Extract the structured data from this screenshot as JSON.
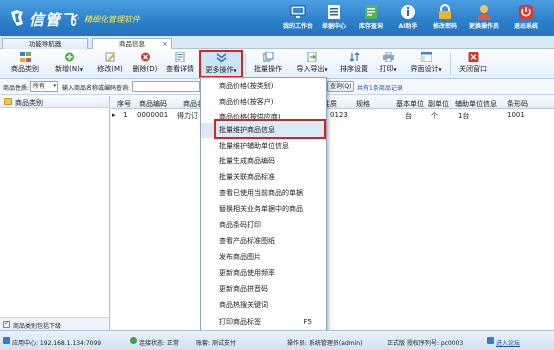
{
  "app": {
    "name": "信管飞",
    "slogan": "精细化管理软件"
  },
  "header_buttons": [
    {
      "label": "我的工作台",
      "icon": "monitor-icon",
      "color": "#2d6fb7"
    },
    {
      "label": "单据中心",
      "icon": "list-icon",
      "color": "#2b5ea8"
    },
    {
      "label": "库存查询",
      "icon": "document-icon",
      "color": "#3aa047"
    },
    {
      "label": "AI助手",
      "icon": "info-icon",
      "color": "#2a66b3"
    },
    {
      "label": "修改密码",
      "icon": "lock-icon",
      "color": "#e5a21e"
    },
    {
      "label": "更换操作员",
      "icon": "user-icon",
      "color": "#f0b43a"
    },
    {
      "label": "退出系统",
      "icon": "power-icon",
      "color": "#d93a2f"
    }
  ],
  "tabs": [
    {
      "label": "功能导航器"
    },
    {
      "label": "商品信息",
      "close": "×"
    }
  ],
  "toolbar": [
    {
      "label": "商品类别",
      "icon": "category-icon"
    },
    {
      "label": "新增(N)",
      "icon": "add-icon",
      "dropdown": "▼"
    },
    {
      "label": "修改(M)",
      "icon": "edit-icon"
    },
    {
      "label": "删除(D)",
      "icon": "delete-icon"
    },
    {
      "label": "查看详情",
      "icon": "detail-icon"
    },
    {
      "label": "更多操作",
      "icon": "more-icon",
      "dropdown": "▼"
    },
    {
      "label": "批量操作",
      "icon": "batch-icon"
    },
    {
      "label": "导入导出",
      "icon": "import-export-icon",
      "dropdown": "▼"
    },
    {
      "label": "排序设置",
      "icon": "sort-icon"
    },
    {
      "label": "打印",
      "icon": "print-icon",
      "dropdown": "▼"
    },
    {
      "label": "界面设计",
      "icon": "design-icon",
      "dropdown": "▼"
    },
    {
      "label": "关闭窗口",
      "icon": "close-window-icon"
    }
  ],
  "filter": {
    "property_label": "商品性质:",
    "property_value": "所有",
    "search_label": "输入商品名称或编码查询:",
    "query_button": "查询(Q)",
    "result_text": "共有1条商品记录"
  },
  "left_panel": {
    "tree_root": "商品类别",
    "footer_checkbox": "商品类别包括下级"
  },
  "grid": {
    "columns": [
      "序号",
      "商品编码",
      "商品名称",
      "性质",
      "规格",
      "基本单位",
      "副单位",
      "辅助单位信息",
      "条形码"
    ],
    "rows": [
      {
        "marker": "▸",
        "index": "1",
        "code": "0000001",
        "name": "得力订",
        "barcode_partial": "0123",
        "property": "",
        "spec": "",
        "unit": "台",
        "sub_unit": "个",
        "aux": "1台",
        "barcode": "1001"
      }
    ]
  },
  "more_menu": {
    "items": [
      {
        "label": "商品价格(按类别)"
      },
      {
        "label": "商品价格(按客户)"
      },
      {
        "label": "商品价格(按供应商)"
      },
      {
        "label": "批量维护商品信息",
        "highlight": true
      },
      {
        "label": "批量维护辅助单位信息"
      },
      {
        "label": "批量生成商品编码"
      },
      {
        "label": "批量关联商品标准"
      },
      {
        "label": "查看已使用当前商品的单据"
      },
      {
        "label": "替换相关业务单据中的商品"
      },
      {
        "label": "商品条码打印"
      },
      {
        "label": "查看产品标准图纸"
      },
      {
        "label": "发布商品图片"
      },
      {
        "label": "更新商品使用频率"
      },
      {
        "label": "更新商品拼音码"
      },
      {
        "label": "商品热搜关键词"
      },
      {
        "label": "打印商品标签",
        "shortcut": "F5"
      }
    ]
  },
  "status_bar": {
    "app_center": "应用中心: 192.168.1.134:7099",
    "connection": "连接状态: 正常",
    "account": "账套: 测试支付",
    "operator": "操作员: 系统管理员(admin)",
    "edition": "正式版 授权序列号: pc0003",
    "forum": "进入论坛",
    "colors": {
      "ok": "#3aa047",
      "accent": "#2c7fc9"
    }
  }
}
